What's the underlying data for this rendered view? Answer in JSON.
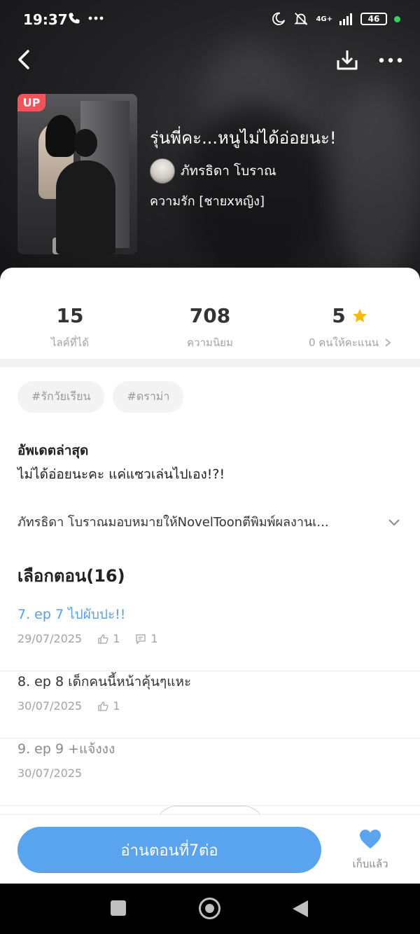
{
  "status_bar": {
    "time": "19:37",
    "network": "4G+",
    "battery": "46"
  },
  "header": {
    "badge": "UP",
    "title": "รุ่นพี่คะ...หนูไม่ได้อ่อยนะ!",
    "author": "ภัทรธิดา โบราณ",
    "genre": "ความรัก [ชายxหญิง]"
  },
  "stats": {
    "likes": {
      "value": "15",
      "label": "ไลค์ที่ได้"
    },
    "popularity": {
      "value": "708",
      "label": "ความนิยม"
    },
    "rating": {
      "value": "5",
      "label": "0 คนให้คะแนน"
    }
  },
  "tags": [
    "#รักวัยเรียน",
    "#ดราม่า"
  ],
  "latest": {
    "title": "อัพเดตล่าสุด",
    "text": "ไม่ได้อ่อยนะคะ แค่แซวเล่นไปเอง!?!"
  },
  "description": "ภัทรธิดา โบราณมอบหมายให้NovelToonตีพิมพ์ผลงานเ...",
  "chapters": {
    "title": "เลือกตอน(16)",
    "items": [
      {
        "title": "7. ep 7 ไปผับปะ!!",
        "date": "29/07/2025",
        "likes": "1",
        "comments": "1"
      },
      {
        "title": "8. ep 8 เด็กคนนี้หน้าคุ้นๆแหะ",
        "date": "30/07/2025",
        "likes": "1"
      },
      {
        "title": "9. ep 9 +แจ้งงง",
        "date": "30/07/2025"
      }
    ]
  },
  "bottom": {
    "read_label": "อ่านตอนที่7ต่อ",
    "fav_label": "เก็บแล้ว"
  },
  "colors": {
    "accent": "#5aa3ef",
    "star": "#f5b90f",
    "badge": "#f2545b"
  }
}
